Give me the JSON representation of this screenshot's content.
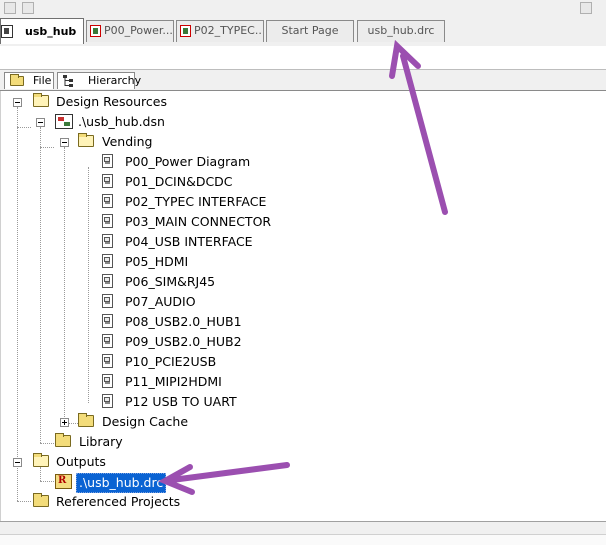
{
  "doc_tabs": [
    {
      "label": "usb_hub",
      "active": true
    },
    {
      "label": "P00_Power...",
      "active": false
    },
    {
      "label": "P02_TYPEC...",
      "active": false
    },
    {
      "label": "Start Page",
      "active": false
    },
    {
      "label": "usb_hub.drc",
      "active": false
    }
  ],
  "panel_tabs": {
    "file": "File",
    "hierarchy": "Hierarchy"
  },
  "tree": {
    "design_resources": "Design Resources",
    "dsn": ".\\usb_hub.dsn",
    "vending": "Vending",
    "pages": [
      "P00_Power Diagram",
      "P01_DCIN&DCDC",
      "P02_TYPEC INTERFACE",
      "P03_MAIN CONNECTOR",
      "P04_USB INTERFACE",
      "P05_HDMI",
      "P06_SIM&RJ45",
      "P07_AUDIO",
      "P08_USB2.0_HUB1",
      "P09_USB2.0_HUB2",
      "P10_PCIE2USB",
      "P11_MIPI2HDMI",
      "P12 USB TO UART"
    ],
    "design_cache": "Design Cache",
    "library": "Library",
    "outputs": "Outputs",
    "drc_file": ".\\usb_hub.drc",
    "referenced_projects": "Referenced Projects"
  },
  "icons": {
    "folder": "folder-icon",
    "page": "schematic-page-icon",
    "design": "design-file-icon",
    "report": "report-file-icon"
  },
  "colors": {
    "selection": "#0a63d3",
    "annotation_arrow": "#9b4fb0"
  }
}
